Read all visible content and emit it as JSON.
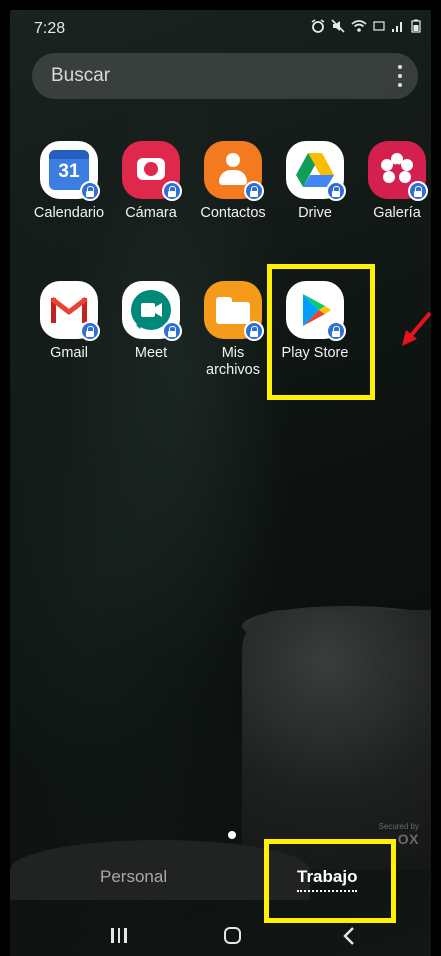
{
  "status_bar": {
    "time": "7:28",
    "icons": [
      "alarm-icon",
      "mute-icon",
      "wifi-icon",
      "lte-icon",
      "signal-icon",
      "battery-icon"
    ]
  },
  "search": {
    "placeholder": "Buscar"
  },
  "apps": [
    {
      "label": "Calendario",
      "icon": "calendar-icon",
      "badge": "31"
    },
    {
      "label": "Cámara",
      "icon": "camera-icon"
    },
    {
      "label": "Contactos",
      "icon": "contacts-icon"
    },
    {
      "label": "Drive",
      "icon": "drive-icon"
    },
    {
      "label": "Galería",
      "icon": "gallery-icon"
    },
    {
      "label": "Gmail",
      "icon": "gmail-icon"
    },
    {
      "label": "Meet",
      "icon": "meet-icon"
    },
    {
      "label": "Mis archivos",
      "label_line1": "Mis",
      "label_line2": "archivos",
      "icon": "folder-icon"
    },
    {
      "label": "Play Store",
      "icon": "play-store-icon"
    }
  ],
  "pagination": {
    "pages": 1,
    "current": 1
  },
  "knox": {
    "small": "Secured by",
    "brand": "OX"
  },
  "tabs": [
    {
      "label": "Personal",
      "selected": false
    },
    {
      "label": "Trabajo",
      "selected": true
    }
  ],
  "colors": {
    "highlight": "#fff200",
    "annotation_arrow": "#e8121c",
    "lock_badge": "#2f6fd6"
  }
}
